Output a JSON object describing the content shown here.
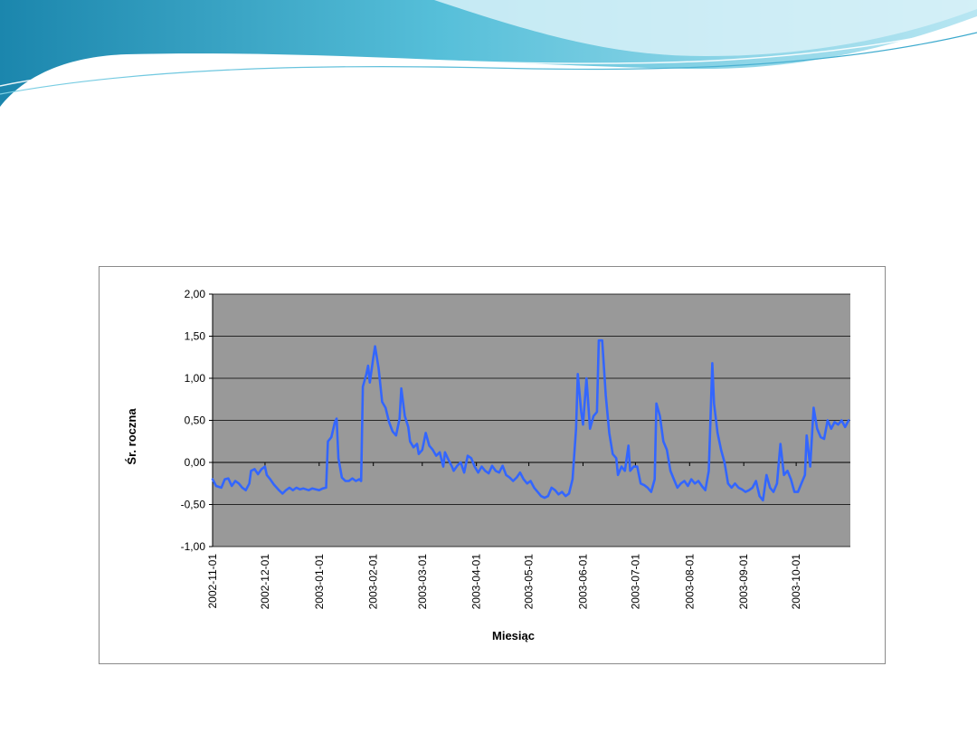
{
  "slide": {
    "accent_colors": [
      "#1a8fb6",
      "#5cc3dc",
      "#bfe8f2"
    ]
  },
  "chart_data": {
    "type": "line",
    "xlabel": "Miesiąc",
    "ylabel": "Śr. roczna",
    "ylim": [
      -1.0,
      2.0
    ],
    "y_ticks": [
      "2,00",
      "1,50",
      "1,00",
      "0,50",
      "0,00",
      "-0,50",
      "-1,00"
    ],
    "x_ticks": [
      "2002-11-01",
      "2002-12-01",
      "2003-01-01",
      "2003-02-01",
      "2003-03-01",
      "2003-04-01",
      "2003-05-01",
      "2003-06-01",
      "2003-07-01",
      "2003-08-01",
      "2003-09-01",
      "2003-10-01"
    ],
    "x_range": [
      "2002-11-01",
      "2003-10-31"
    ],
    "grid": true,
    "legend": "none",
    "plot_background": "#999999",
    "series": [
      {
        "color": "#3366ff",
        "points": [
          [
            "2002-11-01",
            -0.2
          ],
          [
            "2002-11-03",
            -0.28
          ],
          [
            "2002-11-06",
            -0.3
          ],
          [
            "2002-11-08",
            -0.2
          ],
          [
            "2002-11-10",
            -0.19
          ],
          [
            "2002-11-12",
            -0.28
          ],
          [
            "2002-11-14",
            -0.22
          ],
          [
            "2002-11-16",
            -0.25
          ],
          [
            "2002-11-18",
            -0.3
          ],
          [
            "2002-11-20",
            -0.33
          ],
          [
            "2002-11-22",
            -0.25
          ],
          [
            "2002-11-23",
            -0.1
          ],
          [
            "2002-11-25",
            -0.08
          ],
          [
            "2002-11-27",
            -0.14
          ],
          [
            "2002-11-29",
            -0.08
          ],
          [
            "2002-12-01",
            -0.05
          ],
          [
            "2002-12-02",
            -0.15
          ],
          [
            "2002-12-04",
            -0.2
          ],
          [
            "2002-12-06",
            -0.26
          ],
          [
            "2002-12-09",
            -0.33
          ],
          [
            "2002-12-11",
            -0.37
          ],
          [
            "2002-12-13",
            -0.33
          ],
          [
            "2002-12-15",
            -0.3
          ],
          [
            "2002-12-17",
            -0.33
          ],
          [
            "2002-12-19",
            -0.3
          ],
          [
            "2002-12-21",
            -0.32
          ],
          [
            "2002-12-23",
            -0.31
          ],
          [
            "2002-12-26",
            -0.33
          ],
          [
            "2002-12-28",
            -0.31
          ],
          [
            "2002-12-30",
            -0.32
          ],
          [
            "2003-01-01",
            -0.33
          ],
          [
            "2003-01-03",
            -0.31
          ],
          [
            "2003-01-05",
            -0.3
          ],
          [
            "2003-01-06",
            0.25
          ],
          [
            "2003-01-08",
            0.3
          ],
          [
            "2003-01-10",
            0.48
          ],
          [
            "2003-01-11",
            0.52
          ],
          [
            "2003-01-12",
            0.05
          ],
          [
            "2003-01-14",
            -0.18
          ],
          [
            "2003-01-16",
            -0.22
          ],
          [
            "2003-01-18",
            -0.22
          ],
          [
            "2003-01-20",
            -0.19
          ],
          [
            "2003-01-22",
            -0.22
          ],
          [
            "2003-01-24",
            -0.2
          ],
          [
            "2003-01-25",
            -0.22
          ],
          [
            "2003-01-26",
            0.9
          ],
          [
            "2003-01-28",
            1.05
          ],
          [
            "2003-01-29",
            1.15
          ],
          [
            "2003-01-30",
            0.95
          ],
          [
            "2003-02-01",
            1.25
          ],
          [
            "2003-02-02",
            1.38
          ],
          [
            "2003-02-04",
            1.12
          ],
          [
            "2003-02-06",
            0.72
          ],
          [
            "2003-02-08",
            0.65
          ],
          [
            "2003-02-10",
            0.48
          ],
          [
            "2003-02-12",
            0.37
          ],
          [
            "2003-02-14",
            0.32
          ],
          [
            "2003-02-16",
            0.52
          ],
          [
            "2003-02-17",
            0.88
          ],
          [
            "2003-02-19",
            0.55
          ],
          [
            "2003-02-21",
            0.42
          ],
          [
            "2003-02-22",
            0.25
          ],
          [
            "2003-02-24",
            0.18
          ],
          [
            "2003-02-26",
            0.22
          ],
          [
            "2003-02-27",
            0.1
          ],
          [
            "2003-03-01",
            0.15
          ],
          [
            "2003-03-03",
            0.35
          ],
          [
            "2003-03-05",
            0.2
          ],
          [
            "2003-03-07",
            0.15
          ],
          [
            "2003-03-09",
            0.08
          ],
          [
            "2003-03-11",
            0.12
          ],
          [
            "2003-03-13",
            -0.05
          ],
          [
            "2003-03-14",
            0.12
          ],
          [
            "2003-03-16",
            0.03
          ],
          [
            "2003-03-18",
            -0.05
          ],
          [
            "2003-03-19",
            -0.1
          ],
          [
            "2003-03-21",
            -0.04
          ],
          [
            "2003-03-23",
            0.0
          ],
          [
            "2003-03-25",
            -0.12
          ],
          [
            "2003-03-27",
            0.08
          ],
          [
            "2003-03-29",
            0.05
          ],
          [
            "2003-03-31",
            -0.05
          ],
          [
            "2003-04-02",
            -0.12
          ],
          [
            "2003-04-04",
            -0.05
          ],
          [
            "2003-04-06",
            -0.1
          ],
          [
            "2003-04-08",
            -0.13
          ],
          [
            "2003-04-10",
            -0.04
          ],
          [
            "2003-04-12",
            -0.1
          ],
          [
            "2003-04-14",
            -0.12
          ],
          [
            "2003-04-16",
            -0.04
          ],
          [
            "2003-04-18",
            -0.15
          ],
          [
            "2003-04-20",
            -0.18
          ],
          [
            "2003-04-22",
            -0.22
          ],
          [
            "2003-04-24",
            -0.18
          ],
          [
            "2003-04-26",
            -0.12
          ],
          [
            "2003-04-28",
            -0.2
          ],
          [
            "2003-04-30",
            -0.25
          ],
          [
            "2003-05-02",
            -0.22
          ],
          [
            "2003-05-04",
            -0.3
          ],
          [
            "2003-05-06",
            -0.35
          ],
          [
            "2003-05-08",
            -0.4
          ],
          [
            "2003-05-10",
            -0.42
          ],
          [
            "2003-05-12",
            -0.4
          ],
          [
            "2003-05-14",
            -0.3
          ],
          [
            "2003-05-16",
            -0.33
          ],
          [
            "2003-05-18",
            -0.38
          ],
          [
            "2003-05-20",
            -0.35
          ],
          [
            "2003-05-22",
            -0.4
          ],
          [
            "2003-05-24",
            -0.37
          ],
          [
            "2003-05-26",
            -0.2
          ],
          [
            "2003-05-28",
            0.4
          ],
          [
            "2003-05-29",
            1.05
          ],
          [
            "2003-05-31",
            0.6
          ],
          [
            "2003-06-01",
            0.45
          ],
          [
            "2003-06-03",
            1.0
          ],
          [
            "2003-06-05",
            0.4
          ],
          [
            "2003-06-07",
            0.55
          ],
          [
            "2003-06-09",
            0.6
          ],
          [
            "2003-06-10",
            1.45
          ],
          [
            "2003-06-12",
            1.45
          ],
          [
            "2003-06-14",
            0.8
          ],
          [
            "2003-06-16",
            0.35
          ],
          [
            "2003-06-18",
            0.1
          ],
          [
            "2003-06-20",
            0.05
          ],
          [
            "2003-06-21",
            -0.15
          ],
          [
            "2003-06-23",
            -0.05
          ],
          [
            "2003-06-25",
            -0.1
          ],
          [
            "2003-06-27",
            0.2
          ],
          [
            "2003-06-28",
            -0.1
          ],
          [
            "2003-06-30",
            -0.05
          ],
          [
            "2003-07-02",
            -0.05
          ],
          [
            "2003-07-04",
            -0.25
          ],
          [
            "2003-07-06",
            -0.27
          ],
          [
            "2003-07-08",
            -0.3
          ],
          [
            "2003-07-10",
            -0.35
          ],
          [
            "2003-07-12",
            -0.2
          ],
          [
            "2003-07-13",
            0.7
          ],
          [
            "2003-07-15",
            0.55
          ],
          [
            "2003-07-17",
            0.25
          ],
          [
            "2003-07-19",
            0.15
          ],
          [
            "2003-07-21",
            -0.1
          ],
          [
            "2003-07-23",
            -0.2
          ],
          [
            "2003-07-25",
            -0.3
          ],
          [
            "2003-07-27",
            -0.25
          ],
          [
            "2003-07-29",
            -0.22
          ],
          [
            "2003-07-31",
            -0.28
          ],
          [
            "2003-08-02",
            -0.2
          ],
          [
            "2003-08-04",
            -0.25
          ],
          [
            "2003-08-06",
            -0.22
          ],
          [
            "2003-08-08",
            -0.28
          ],
          [
            "2003-08-10",
            -0.33
          ],
          [
            "2003-08-12",
            -0.1
          ],
          [
            "2003-08-13",
            0.55
          ],
          [
            "2003-08-14",
            1.18
          ],
          [
            "2003-08-15",
            0.7
          ],
          [
            "2003-08-17",
            0.35
          ],
          [
            "2003-08-19",
            0.15
          ],
          [
            "2003-08-21",
            0.0
          ],
          [
            "2003-08-23",
            -0.25
          ],
          [
            "2003-08-25",
            -0.3
          ],
          [
            "2003-08-27",
            -0.25
          ],
          [
            "2003-08-29",
            -0.3
          ],
          [
            "2003-08-31",
            -0.32
          ],
          [
            "2003-09-02",
            -0.35
          ],
          [
            "2003-09-04",
            -0.33
          ],
          [
            "2003-09-06",
            -0.3
          ],
          [
            "2003-09-08",
            -0.22
          ],
          [
            "2003-09-10",
            -0.4
          ],
          [
            "2003-09-12",
            -0.45
          ],
          [
            "2003-09-14",
            -0.15
          ],
          [
            "2003-09-16",
            -0.3
          ],
          [
            "2003-09-18",
            -0.35
          ],
          [
            "2003-09-20",
            -0.25
          ],
          [
            "2003-09-22",
            0.22
          ],
          [
            "2003-09-24",
            -0.15
          ],
          [
            "2003-09-26",
            -0.1
          ],
          [
            "2003-09-28",
            -0.2
          ],
          [
            "2003-09-30",
            -0.35
          ],
          [
            "2003-10-02",
            -0.35
          ],
          [
            "2003-10-04",
            -0.25
          ],
          [
            "2003-10-06",
            -0.15
          ],
          [
            "2003-10-07",
            0.32
          ],
          [
            "2003-10-09",
            -0.05
          ],
          [
            "2003-10-10",
            0.3
          ],
          [
            "2003-10-11",
            0.65
          ],
          [
            "2003-10-13",
            0.4
          ],
          [
            "2003-10-15",
            0.3
          ],
          [
            "2003-10-17",
            0.28
          ],
          [
            "2003-10-19",
            0.5
          ],
          [
            "2003-10-21",
            0.4
          ],
          [
            "2003-10-23",
            0.48
          ],
          [
            "2003-10-25",
            0.45
          ],
          [
            "2003-10-27",
            0.5
          ],
          [
            "2003-10-29",
            0.42
          ],
          [
            "2003-10-31",
            0.5
          ]
        ]
      }
    ]
  }
}
